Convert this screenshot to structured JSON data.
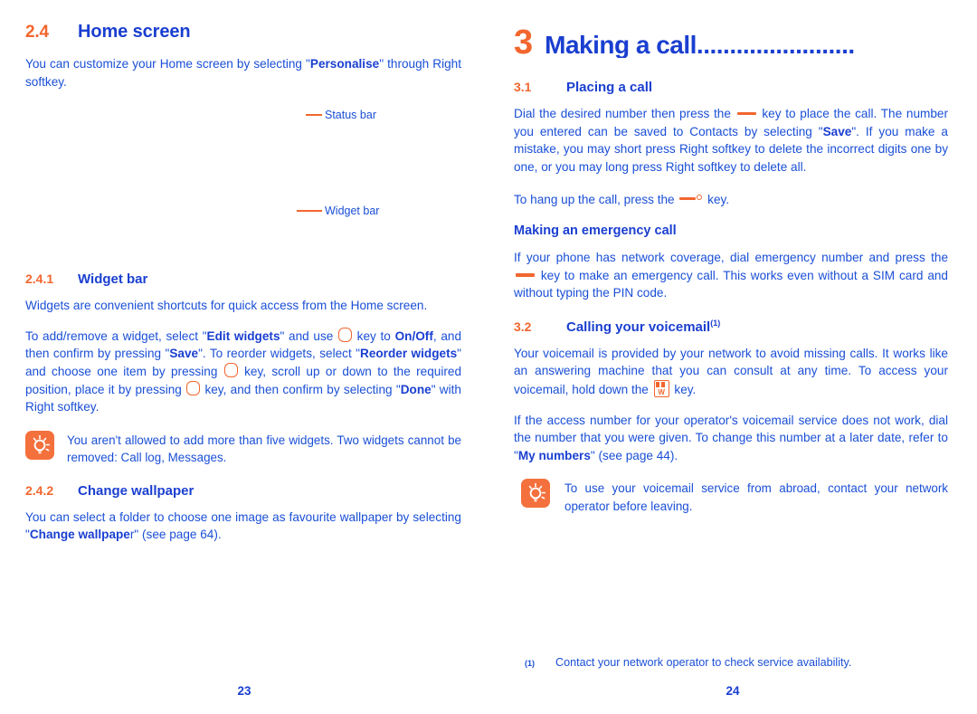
{
  "colors": {
    "body_blue": "#1a4fd6",
    "heading_blue": "#1a3fd0",
    "accent_orange": "#f2662e",
    "tip_box_orange": "#f4703c",
    "page_background": "#ffffff"
  },
  "left_page": {
    "folio": "23",
    "section": {
      "number": "2.4",
      "title": "Home screen"
    },
    "intro": {
      "part1": "You can customize your Home screen by selecting \"",
      "bold1": "Personalise",
      "part2": "\" through Right softkey."
    },
    "illustration": {
      "callouts": [
        {
          "label": "Status bar",
          "name": "status-bar"
        },
        {
          "label": "Widget bar",
          "name": "widget-bar"
        }
      ]
    },
    "subsection_widget_bar": {
      "number": "2.4.1",
      "title": "Widget bar",
      "paragraph1": "Widgets are convenient shortcuts for quick access from the Home screen.",
      "paragraph2": {
        "s1": "To add/remove a widget, select \"",
        "b1": "Edit widgets",
        "s2": "\" and use ",
        "s3": " key to ",
        "b2": "On/Off",
        "s4": ", and then confirm by pressing \"",
        "b3": "Save",
        "s5": "\". To reorder widgets, select \"",
        "b4": "Reorder widgets",
        "s6": "\" and choose one item by pressing ",
        "s7": " key, scroll up or down to the required position, place it by pressing ",
        "s8": " key, and then confirm by selecting \"",
        "b5": "Done",
        "s9": "\" with Right softkey."
      },
      "tip": "You aren't allowed to add more than five widgets. Two widgets cannot be removed: Call log, Messages."
    },
    "subsection_change_wallpaper": {
      "number": "2.4.2",
      "title": "Change wallpaper",
      "paragraph": {
        "s1": "You can select a folder to choose one image as favourite wallpaper by selecting \"",
        "b1": "Change wallpape",
        "s2": "r\" (see page 64)."
      }
    }
  },
  "right_page": {
    "folio": "24",
    "chapter": {
      "number": "3",
      "title": "Making a call........................"
    },
    "section_placing": {
      "number": "3.1",
      "title": "Placing a call",
      "paragraph1": {
        "s1": "Dial the desired number then press the ",
        "s2": " key to place the call. The number you entered can be saved to Contacts by selecting \"",
        "b1": "Save",
        "s3": "\".  If you make a mistake, you may short press Right softkey to delete the incorrect digits one by one, or you may long press Right softkey to delete all."
      },
      "paragraph2": {
        "s1": "To hang up the call, press the ",
        "s2": " key."
      },
      "emergency_heading": "Making an emergency call",
      "emergency_paragraph": {
        "s1": "If your phone has network coverage, dial emergency number and press the ",
        "s2": " key to make an emergency call. This works even without a SIM card and without typing the PIN code."
      }
    },
    "section_voicemail": {
      "number": "3.2",
      "title": "Calling your voicemail",
      "footnote_marker": "(1)",
      "paragraph1": {
        "s1": "Your voicemail is provided by your network to avoid missing calls. It works like an answering machine that you can consult at any time. To access your voicemail, hold down the ",
        "s2": " key."
      },
      "paragraph2": {
        "s1": "If the access number for your operator's voicemail service does not work, dial the number that you were given. To change this number at a later date, refer to \"",
        "b1": "My numbers",
        "s2": "\" (see page 44)."
      },
      "tip": "To use your voicemail service from abroad, contact your network operator before leaving."
    },
    "footnote": {
      "marker": "(1)",
      "text": "Contact your network operator to check service availability."
    }
  },
  "icons": {
    "tip_icon": "lightbulb-icon",
    "key_round": "navigation-key-icon",
    "key_bar": "call-key-icon",
    "key_bar_ring": "hangup-key-icon",
    "key_voicemail": "voicemail-key-icon"
  }
}
